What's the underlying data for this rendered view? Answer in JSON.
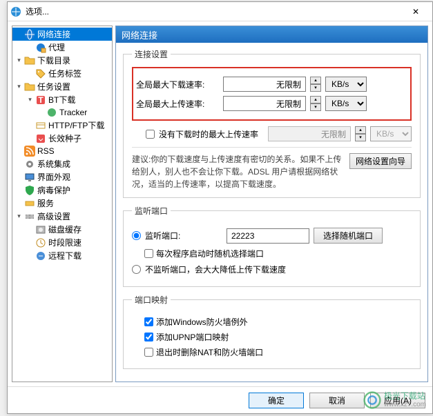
{
  "window": {
    "title": "选项...",
    "close_glyph": "✕"
  },
  "tree": {
    "items": [
      {
        "id": "network",
        "label": "网络连接",
        "indent": 0,
        "expander": "",
        "icon": "globe",
        "selected": true
      },
      {
        "id": "proxy",
        "label": "代理",
        "indent": 1,
        "expander": "",
        "icon": "globe-proxy"
      },
      {
        "id": "dldir",
        "label": "下载目录",
        "indent": 0,
        "expander": "▾",
        "icon": "folder"
      },
      {
        "id": "tasktag",
        "label": "任务标签",
        "indent": 1,
        "expander": "",
        "icon": "tag"
      },
      {
        "id": "taskset",
        "label": "任务设置",
        "indent": 0,
        "expander": "▾",
        "icon": "folder-task"
      },
      {
        "id": "bt",
        "label": "BT下载",
        "indent": 1,
        "expander": "▾",
        "icon": "bt"
      },
      {
        "id": "tracker",
        "label": "Tracker",
        "indent": 2,
        "expander": "",
        "icon": "tracker"
      },
      {
        "id": "httpftp",
        "label": "HTTP/FTP下载",
        "indent": 1,
        "expander": "",
        "icon": "http"
      },
      {
        "id": "longseed",
        "label": "长效种子",
        "indent": 1,
        "expander": "",
        "icon": "seed"
      },
      {
        "id": "rss",
        "label": "RSS",
        "indent": 0,
        "expander": "",
        "icon": "rss"
      },
      {
        "id": "sysint",
        "label": "系统集成",
        "indent": 0,
        "expander": "",
        "icon": "gear"
      },
      {
        "id": "ui",
        "label": "界面外观",
        "indent": 0,
        "expander": "",
        "icon": "monitor"
      },
      {
        "id": "virus",
        "label": "病毒保护",
        "indent": 0,
        "expander": "",
        "icon": "shield"
      },
      {
        "id": "service",
        "label": "服务",
        "indent": 0,
        "expander": "",
        "icon": "service"
      },
      {
        "id": "advanced",
        "label": "高级设置",
        "indent": 0,
        "expander": "▾",
        "icon": "adv"
      },
      {
        "id": "diskcache",
        "label": "磁盘缓存",
        "indent": 1,
        "expander": "",
        "icon": "disk"
      },
      {
        "id": "speedlimit",
        "label": "时段限速",
        "indent": 1,
        "expander": "",
        "icon": "clock"
      },
      {
        "id": "remote",
        "label": "远程下载",
        "indent": 1,
        "expander": "",
        "icon": "remote"
      }
    ]
  },
  "panel": {
    "title": "网络连接",
    "conn": {
      "legend": "连接设置",
      "dl_label": "全局最大下载速率:",
      "dl_value": "无限制",
      "ul_label": "全局最大上传速率:",
      "ul_value": "无限制",
      "unit": "KB/s",
      "noDl_label": "没有下载时的最大上传速率",
      "noDl_value": "无限制",
      "advice": "建议:你的下载速度与上传速度有密切的关系。如果不上传给别人，别人也不会让你下载。ADSL 用户请根据网络状况，适当的上传速率，以提高下载速度。",
      "wizard_btn": "网络设置向导"
    },
    "listen": {
      "legend": "监听端口",
      "radio_listen": "监听端口:",
      "port_value": "22223",
      "random_btn": "选择随机端口",
      "chk_random_label": "每次程序启动时随机选择端口",
      "radio_nolisten": "不监听端口，会大大降低上传下载速度"
    },
    "portmap": {
      "legend": "端口映射",
      "chk_firewall": "添加Windows防火墙例外",
      "chk_upnp": "添加UPNP端口映射",
      "chk_nat": "退出时删除NAT和防火墙端口",
      "fw_checked": true,
      "upnp_checked": true,
      "nat_checked": false
    }
  },
  "footer": {
    "ok": "确定",
    "cancel": "取消",
    "apply": "应用(A)"
  },
  "watermark": {
    "name": "极光下载站",
    "url": "www.xz7.com"
  },
  "icons": {
    "globe": "#1e7dd6",
    "folder": "#f5c24b",
    "rss": "#f28c28",
    "shield": "#2fa84f"
  }
}
